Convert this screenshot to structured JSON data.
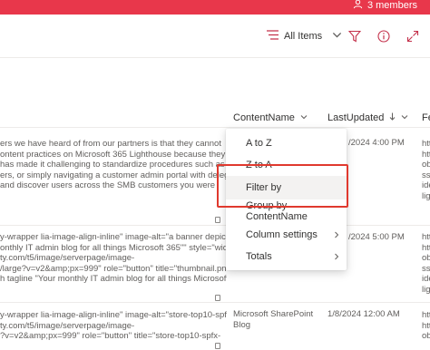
{
  "header": {
    "members_label": "3 members"
  },
  "commandbar": {
    "view_label": "All Items"
  },
  "columns": {
    "content_name": "ContentName",
    "last_updated": "LastUpdated",
    "next_partial": "Fe"
  },
  "rows": [
    {
      "text_lines": [
        "ers we have heard of from our partners is that they cannot",
        "ontent practices on Microsoft 365 Lighthouse because they cannot",
        "has made it challenging to standardize procedures such as",
        "ers, or simply navigating a customer admin portal with delegated",
        "and discover users across the SMB customers you were"
      ],
      "name": "",
      "date": "/2024 4:00 PM",
      "right_lines": [
        "htt",
        "htt",
        "ob",
        "ss",
        "ide",
        "lig"
      ]
    },
    {
      "text_lines": [
        "y-wrapper lia-image-align-inline\" image-alt=\"a banner depicting",
        "onthly IT admin blog for all things Microsoft 365\"\" style=\"width:",
        "ty.com/t5/image/serverpage/image-",
        "/large?v=v2&amp;px=999\" role=\"button\" title=\"thumbnail.png\"",
        "h tagline \"Your monthly IT admin blog for all things Microsoft"
      ],
      "name": "",
      "date": "/2024 5:00 PM",
      "right_lines": [
        "htt",
        "htt",
        "ob",
        "ss",
        "ide",
        "lig"
      ]
    },
    {
      "text_lines": [
        "y-wrapper lia-image-align-inline\" image-alt=\"store-top10-spfx-",
        "ty.com/t5/image/serverpage/image-",
        "?v=v2&amp;px=999\" role=\"button\" title=\"store-top10-spfx-"
      ],
      "name_lines": [
        "Microsoft SharePoint",
        "Blog"
      ],
      "date": "1/8/2024 12:00 AM",
      "right_lines": [
        "htt",
        "htt",
        "ob"
      ]
    }
  ],
  "menu": {
    "items": [
      {
        "label": "A to Z"
      },
      {
        "label": "Z to A"
      },
      {
        "label": "Filter by"
      },
      {
        "label": "Group by ContentName"
      },
      {
        "label": "Column settings"
      },
      {
        "label": "Totals"
      }
    ]
  },
  "colors": {
    "banner": "#e8374b",
    "highlight": "#e0392e",
    "brand": "#c4314b"
  },
  "icons": [
    "person-icon",
    "list-view-icon",
    "chevron-down-icon",
    "filter-icon",
    "info-icon",
    "expand-icon",
    "sort-arrow-icon",
    "chevron-right-icon",
    "file-icon"
  ]
}
